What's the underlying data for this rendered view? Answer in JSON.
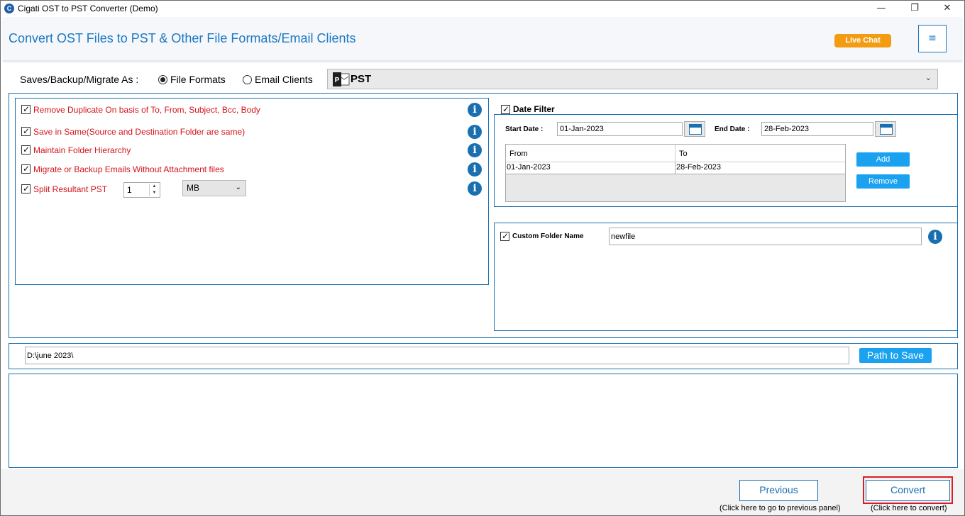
{
  "window": {
    "title": "Cigati OST to PST Converter (Demo)",
    "minimize": "—",
    "maximize": "❐",
    "close": "✕"
  },
  "header": {
    "title": "Convert OST Files to PST & Other File Formats/Email Clients",
    "live_chat": "Live Chat",
    "menu_icon": "≡"
  },
  "save_as": {
    "label": "Saves/Backup/Migrate As :",
    "options": [
      {
        "label": "File Formats",
        "selected": true
      },
      {
        "label": "Email Clients",
        "selected": false
      }
    ],
    "format_selected": "PST",
    "format_icon": "outlook-pst-icon"
  },
  "options": {
    "items": [
      {
        "label": "Remove Duplicate On basis of To, From, Subject, Bcc, Body",
        "checked": true
      },
      {
        "label": "Save in Same(Source and Destination Folder are same)",
        "checked": true
      },
      {
        "label": "Maintain Folder Hierarchy",
        "checked": true
      },
      {
        "label": "Migrate or Backup Emails Without Attachment files",
        "checked": true
      },
      {
        "label": "Split Resultant PST",
        "checked": true
      }
    ],
    "split_value": "1",
    "split_unit": "MB",
    "info_glyph": "i"
  },
  "date_filter": {
    "label": "Date Filter",
    "checked": true,
    "start_label": "Start Date :",
    "start_value": "01-Jan-2023",
    "end_label": "End Date :",
    "end_value": "28-Feb-2023",
    "columns": [
      "From",
      "To"
    ],
    "rows": [
      {
        "from": "01-Jan-2023",
        "to": "28-Feb-2023"
      }
    ],
    "add_label": "Add",
    "remove_label": "Remove"
  },
  "custom_folder": {
    "label": "Custom Folder Name",
    "checked": true,
    "value": "newfile"
  },
  "path": {
    "value": "D:\\june 2023\\",
    "button": "Path to Save"
  },
  "footer": {
    "previous_label": "Previous",
    "previous_hint": "(Click here to go to previous panel)",
    "convert_label": "Convert",
    "convert_hint": "(Click here to convert)"
  },
  "colors": {
    "accent": "#1a6fb0",
    "title_blue": "#1a78c2",
    "option_red": "#d4141b",
    "live_chat": "#f39c12",
    "button_blue": "#1aa2f0",
    "highlight_red": "#d81e2a"
  }
}
